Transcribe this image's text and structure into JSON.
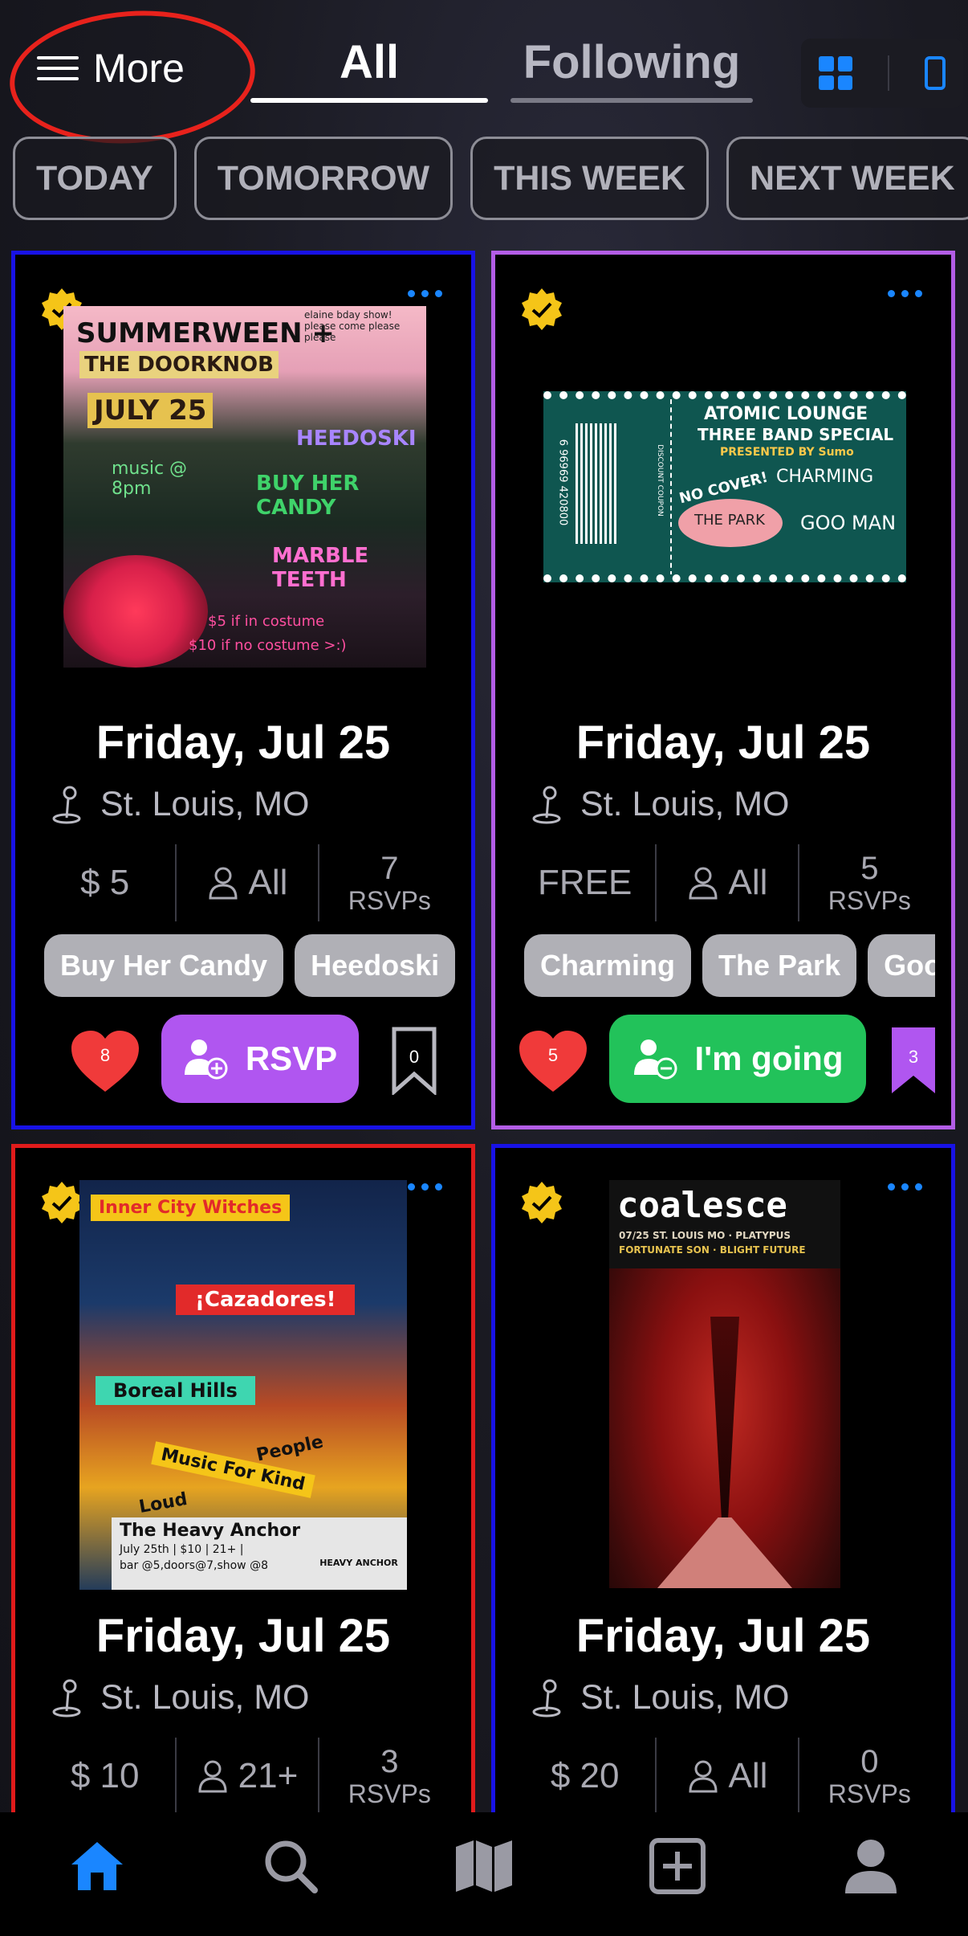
{
  "header": {
    "more_label": "More",
    "tabs": [
      {
        "label": "All",
        "active": true
      },
      {
        "label": "Following",
        "active": false
      }
    ],
    "view_toggle": {
      "grid_icon": "grid-icon",
      "single_icon": "phone-icon",
      "selected": "grid"
    }
  },
  "filters": [
    "TODAY",
    "TOMORROW",
    "THIS WEEK",
    "NEXT WEEK"
  ],
  "colors": {
    "accent_blue": "#1a86ff",
    "rsvp_purple": "#b056f0",
    "going_green": "#22c25a",
    "heart_red": "#f03a3a",
    "verified_yellow": "#f5c518",
    "annotation_red": "#e8221c"
  },
  "cards": [
    {
      "border_color": "#1812e6",
      "poster": {
        "lines": [
          "SUMMERWEEN +",
          "THE DOORKNOB",
          "JULY 25",
          "music @ 8pm",
          "HEEDOSKI",
          "BUY HER CANDY",
          "MARBLE TEETH",
          "$5 if in costume",
          "$10 if no costume >:)",
          "elaine bday show! please come please please"
        ]
      },
      "date": "Friday, Jul 25",
      "location": "St. Louis, MO",
      "price": "$ 5",
      "age": "All",
      "rsvp_count": "7",
      "rsvp_label": "RSVPs",
      "tags": [
        "Buy Her Candy",
        "Heedoski"
      ],
      "likes": "8",
      "action_label": "RSVP",
      "saves": "0"
    },
    {
      "border_color": "#b35de6",
      "poster": {
        "lines": [
          "ATOMIC LOUNGE",
          "THREE BAND SPECIAL",
          "PRESENTED BY Sumo",
          "NO COVER!",
          "CHARMING",
          "THE PARK",
          "GOO MAN",
          "DISCOUNT COUPON",
          "6 96969 420800"
        ]
      },
      "date": "Friday, Jul 25",
      "location": "St. Louis, MO",
      "price": "FREE",
      "age": "All",
      "rsvp_count": "5",
      "rsvp_label": "RSVPs",
      "tags": [
        "Charming",
        "The Park",
        "Goo"
      ],
      "likes": "5",
      "action_label": "I'm going",
      "saves": "3"
    },
    {
      "border_color": "#e01b1b",
      "poster": {
        "lines": [
          "Inner City Witches",
          "¡Cazadores!",
          "Boreal Hills",
          "People",
          "Music For Kind",
          "Loud",
          "The Heavy Anchor",
          "July 25th | $10 | 21+ |",
          "bar @5,doors@7,show @8",
          "HEAVY ANCHOR"
        ]
      },
      "date": "Friday, Jul 25",
      "location": "St. Louis, MO",
      "price": "$ 10",
      "age": "21+",
      "rsvp_count": "3",
      "rsvp_label": "RSVPs"
    },
    {
      "border_color": "#1812e6",
      "poster": {
        "lines": [
          "coalesce",
          "07/25 ST. LOUIS MO · PLATYPUS",
          "FORTUNATE SON · BLIGHT FUTURE"
        ]
      },
      "date": "Friday, Jul 25",
      "location": "St. Louis, MO",
      "price": "$ 20",
      "age": "All",
      "rsvp_count": "0",
      "rsvp_label": "RSVPs"
    }
  ],
  "bottom_nav": [
    {
      "icon": "home-icon",
      "active": true
    },
    {
      "icon": "search-icon",
      "active": false
    },
    {
      "icon": "map-icon",
      "active": false
    },
    {
      "icon": "add-icon",
      "active": false
    },
    {
      "icon": "profile-icon",
      "active": false
    }
  ]
}
